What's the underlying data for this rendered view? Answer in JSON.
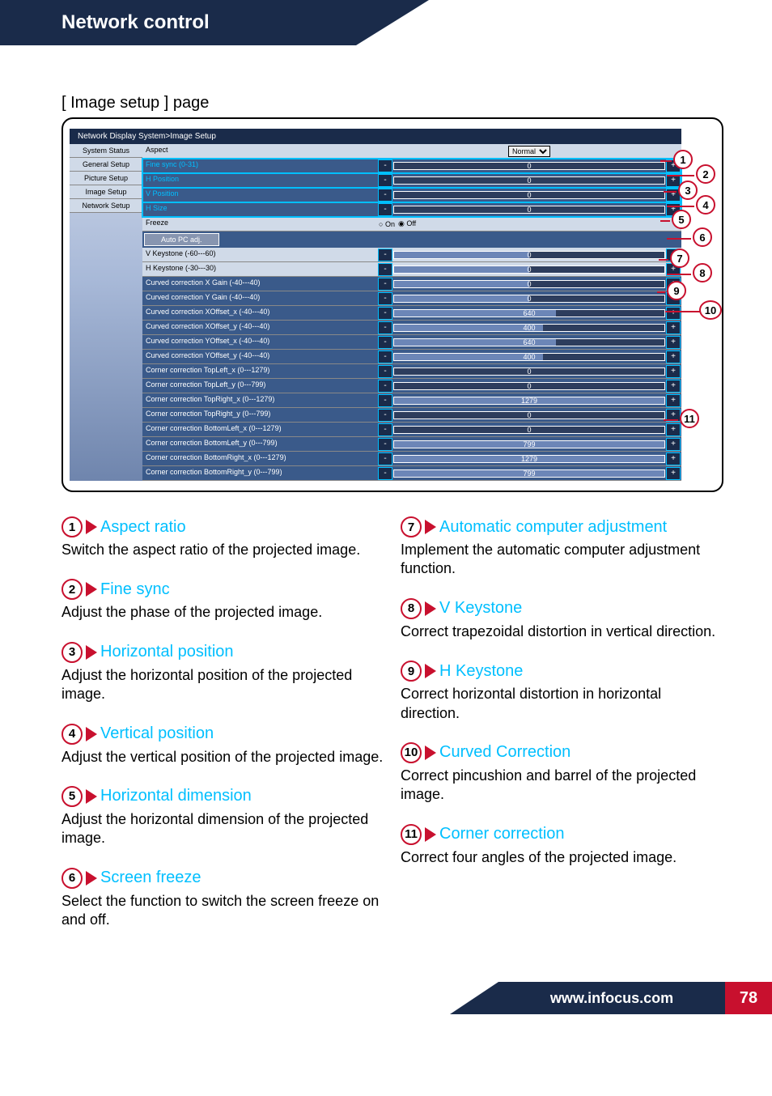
{
  "titlebar": "Network control",
  "section_title": "[ Image setup ] page",
  "breadcrumb": "Network Display System>Image Setup",
  "sidebar": {
    "items": [
      {
        "label": "System Status"
      },
      {
        "label": "General Setup"
      },
      {
        "label": "Picture Setup"
      },
      {
        "label": "Image Setup"
      },
      {
        "label": "Network Setup"
      }
    ]
  },
  "rows": {
    "aspect": {
      "label": "Aspect",
      "type": "select",
      "value": "Normal"
    },
    "finesync": {
      "label": "Fine sync (0-31)",
      "type": "slider",
      "value": "0",
      "hi": true
    },
    "hpos": {
      "label": "H Position",
      "type": "slider",
      "value": "0",
      "hi": true
    },
    "vpos": {
      "label": "V Position",
      "type": "slider",
      "value": "0",
      "hi": true
    },
    "hsize": {
      "label": "H Size",
      "type": "slider",
      "value": "0",
      "hi": true
    },
    "freeze": {
      "label": "Freeze",
      "type": "radio",
      "on": "On",
      "off": "Off"
    },
    "autopc": {
      "label": "Auto PC adj."
    },
    "vkey": {
      "label": "V Keystone (-60---60)",
      "value": "0"
    },
    "hkey": {
      "label": "H Keystone (-30---30)",
      "value": "0"
    },
    "cxg": {
      "label": "Curved correction X Gain (-40---40)",
      "value": "0"
    },
    "cyg": {
      "label": "Curved correction Y Gain (-40---40)",
      "value": "0"
    },
    "cxox": {
      "label": "Curved correction XOffset_x (-40---40)",
      "value": "640"
    },
    "cxoy": {
      "label": "Curved correction XOffset_y (-40---40)",
      "value": "400"
    },
    "cyox": {
      "label": "Curved correction YOffset_x (-40---40)",
      "value": "640"
    },
    "cyoy": {
      "label": "Curved correction YOffset_y (-40---40)",
      "value": "400"
    },
    "tlx": {
      "label": "Corner correction TopLeft_x (0---1279)",
      "value": "0"
    },
    "tly": {
      "label": "Corner correction TopLeft_y (0---799)",
      "value": "0"
    },
    "trx": {
      "label": "Corner correction TopRight_x (0---1279)",
      "value": "1279"
    },
    "try": {
      "label": "Corner correction TopRight_y (0---799)",
      "value": "0"
    },
    "blx": {
      "label": "Corner correction BottomLeft_x (0---1279)",
      "value": "0"
    },
    "bly": {
      "label": "Corner correction BottomLeft_y (0---799)",
      "value": "799"
    },
    "brx": {
      "label": "Corner correction BottomRight_x (0---1279)",
      "value": "1279"
    },
    "bry": {
      "label": "Corner correction BottomRight_y (0---799)",
      "value": "799"
    }
  },
  "callouts": [
    "1",
    "2",
    "3",
    "4",
    "5",
    "6",
    "7",
    "8",
    "9",
    "10",
    "11"
  ],
  "desc": {
    "left": [
      {
        "n": "1",
        "title": "Aspect ratio",
        "body": "Switch the aspect ratio of the projected image."
      },
      {
        "n": "2",
        "title": "Fine sync",
        "body": "Adjust the phase of the projected image."
      },
      {
        "n": "3",
        "title": "Horizontal position",
        "body": "Adjust the horizontal position of the projected image."
      },
      {
        "n": "4",
        "title": "Vertical position",
        "body": "Adjust the vertical position of the projected image."
      },
      {
        "n": "5",
        "title": "Horizontal dimension",
        "body": "Adjust the horizontal dimension of the projected image."
      },
      {
        "n": "6",
        "title": "Screen freeze",
        "body": "Select the function to switch the screen freeze on and off."
      }
    ],
    "right": [
      {
        "n": "7",
        "title": "Automatic computer adjustment",
        "body": "Implement the automatic computer adjustment function."
      },
      {
        "n": "8",
        "title": "V Keystone",
        "body": "Correct trapezoidal distortion in vertical direction."
      },
      {
        "n": "9",
        "title": "H Keystone",
        "body": "Correct horizontal distortion in horizontal direction."
      },
      {
        "n": "10",
        "title": "Curved Correction",
        "body": "Correct pincushion and barrel of the projected image."
      },
      {
        "n": "11",
        "title": "Corner correction",
        "body": "Correct four angles of the projected image."
      }
    ]
  },
  "footer": {
    "url": "www.infocus.com",
    "page": "78"
  }
}
